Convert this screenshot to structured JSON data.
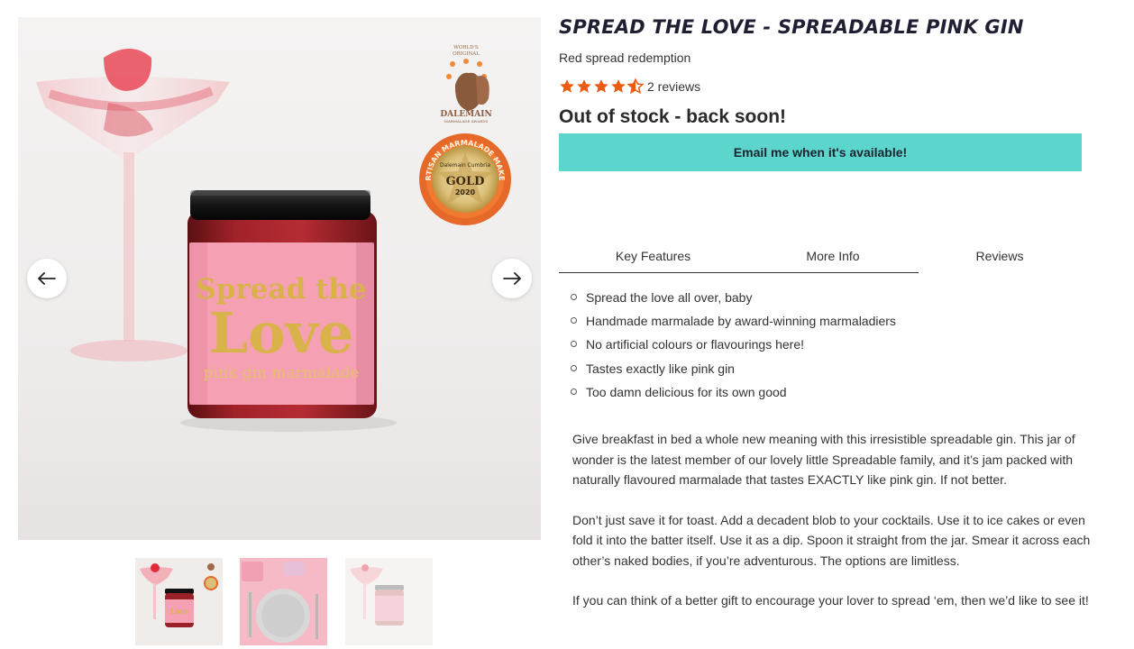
{
  "product": {
    "title": "SPREAD THE LOVE - SPREADABLE PINK GIN",
    "subtitle": "Red spread redemption",
    "rating": 4.5,
    "rating_max": 5,
    "reviews_label": "2 reviews",
    "stock_status": "Out of stock - back soon!",
    "notify_button": "Email me when it's available!"
  },
  "gallery": {
    "prev_icon": "arrow-left-icon",
    "next_icon": "arrow-right-icon",
    "jar_label": {
      "line1": "Spread the",
      "line2": "Love",
      "line3": "pink gin marmalade"
    },
    "badge_top": {
      "line1": "WORLD'S",
      "line2": "ORIGINAL",
      "brand": "DALEMAIN",
      "line3": "MARMALADE AWARDS"
    },
    "badge_medal": {
      "ring_text": "ARTISAN MARMALADE MAKER",
      "inner_text": "Dalemain Cumbria",
      "award": "GOLD",
      "year": "2020"
    },
    "thumbnails": [
      "jar-photo",
      "table-setting-photo",
      "jar-faded-photo"
    ]
  },
  "tabs": [
    {
      "label": "Key Features"
    },
    {
      "label": "More Info"
    },
    {
      "label": "Reviews"
    }
  ],
  "features": [
    "Spread the love all over, baby",
    "Handmade marmalade by award-winning marmaladiers",
    "No artificial colours or flavourings here!",
    "Tastes exactly like pink gin",
    "Too damn delicious for its own good"
  ],
  "description": [
    "Give breakfast in bed a whole new meaning with this irresistible spreadable gin. This jar of wonder is the latest member of our lovely little Spreadable family, and it’s jam packed with naturally flavoured marmalade that tastes EXACTLY like pink gin. If not better.",
    "Don’t just save it for toast. Add a decadent blob to your cocktails. Use it to ice cakes or even fold it into the batter itself. Use it as a dip. Spoon it straight from the jar. Smear it across each other’s naked bodies, if you’re adventurous. The options are limitless.",
    "If you can think of a better gift to encourage your lover to spread ‘em, then we’d like to see it!"
  ],
  "colors": {
    "accent_teal": "#5cd6cc",
    "star_orange": "#ec5b13",
    "jar_pink": "#f6a0b4",
    "label_gold": "#d9b24a"
  }
}
